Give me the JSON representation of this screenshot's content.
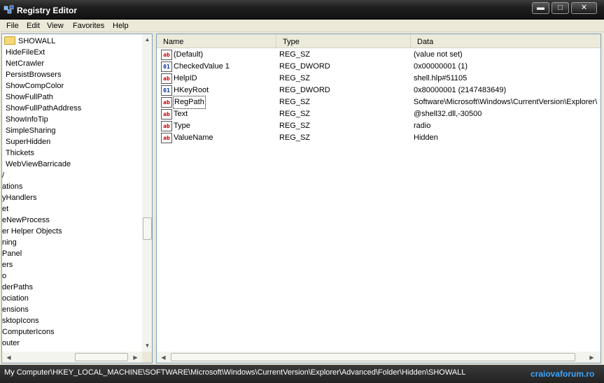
{
  "window": {
    "title": "Registry Editor"
  },
  "window_buttons": {
    "minimize": "▬",
    "maximize": "□",
    "close": "✕"
  },
  "menu": [
    "File",
    "Edit",
    "View",
    "Favorites",
    "Help"
  ],
  "tree": {
    "selected": "SHOWALL",
    "items": [
      "SHOWALL",
      "HideFileExt",
      "NetCrawler",
      "PersistBrowsers",
      "ShowCompColor",
      "ShowFullPath",
      "ShowFullPathAddress",
      "ShowInfoTip",
      "SimpleSharing",
      "SuperHidden",
      "Thickets",
      "WebViewBarricade",
      "/",
      "ations",
      "yHandlers",
      "et",
      "eNewProcess",
      "er Helper Objects",
      "ning",
      "Panel",
      "ers",
      "o",
      "derPaths",
      "ociation",
      "ensions",
      "sktopIcons",
      "ComputerIcons",
      "outer"
    ]
  },
  "list": {
    "columns": [
      "Name",
      "Type",
      "Data"
    ],
    "rows": [
      {
        "name": "(Default)",
        "type": "REG_SZ",
        "data": "(value not set)",
        "icon": "ab"
      },
      {
        "name": "CheckedValue 1",
        "type": "REG_DWORD",
        "data": "0x00000001 (1)",
        "icon": "dword"
      },
      {
        "name": "HelpID",
        "type": "REG_SZ",
        "data": "shell.hlp#51105",
        "icon": "ab"
      },
      {
        "name": "HKeyRoot",
        "type": "REG_DWORD",
        "data": "0x80000001 (2147483649)",
        "icon": "dword"
      },
      {
        "name": "RegPath",
        "type": "REG_SZ",
        "data": "Software\\Microsoft\\Windows\\CurrentVersion\\Explorer\\",
        "icon": "ab"
      },
      {
        "name": "Text",
        "type": "REG_SZ",
        "data": "@shell32.dll,-30500",
        "icon": "ab"
      },
      {
        "name": "Type",
        "type": "REG_SZ",
        "data": "radio",
        "icon": "ab"
      },
      {
        "name": "ValueName",
        "type": "REG_SZ",
        "data": "Hidden",
        "icon": "ab"
      }
    ]
  },
  "icons": {
    "ab": "ab",
    "dword": "01\n10"
  },
  "status": {
    "path": "My Computer\\HKEY_LOCAL_MACHINE\\SOFTWARE\\Microsoft\\Windows\\CurrentVersion\\Explorer\\Advanced\\Folder\\Hidden\\SHOWALL",
    "watermark": "craiovaforum.ro"
  },
  "scroll": {
    "left_arrow": "◀",
    "right_arrow": "▶",
    "up_arrow": "▲",
    "down_arrow": "▼"
  }
}
